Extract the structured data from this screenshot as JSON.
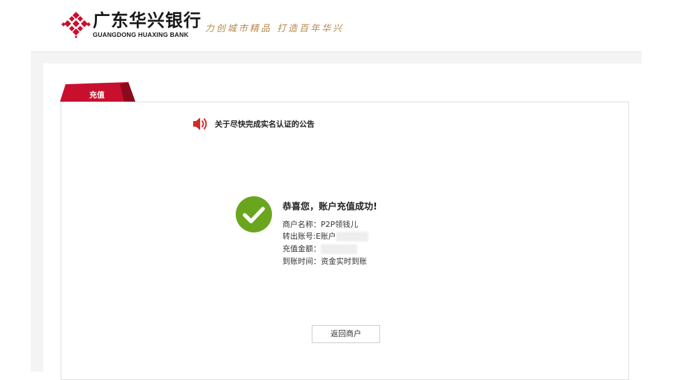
{
  "header": {
    "bank_name_cn": "广东华兴银行",
    "bank_name_en": "GUANGDONG HUAXING BANK",
    "slogan": "力创城市精品 打造百年华兴"
  },
  "tab": {
    "label": "充值"
  },
  "notice": {
    "icon": "speaker-icon",
    "text": "关于尽快完成实名认证的公告"
  },
  "result": {
    "icon": "check-circle-icon",
    "title": "恭喜您，账户充值成功!",
    "merchant_label": "商户名称：",
    "merchant_value": "P2P领钱儿",
    "account_label": "转出账号:",
    "account_value": "E账户",
    "amount_label": "充值金额：",
    "amount_value": "",
    "time_label": "到账时间：",
    "time_value": "资金实时到账"
  },
  "actions": {
    "back_label": "返回商户"
  },
  "colors": {
    "brand_red": "#c8102e",
    "success_green": "#6aa51e",
    "slogan_gold": "#b58a4a"
  }
}
